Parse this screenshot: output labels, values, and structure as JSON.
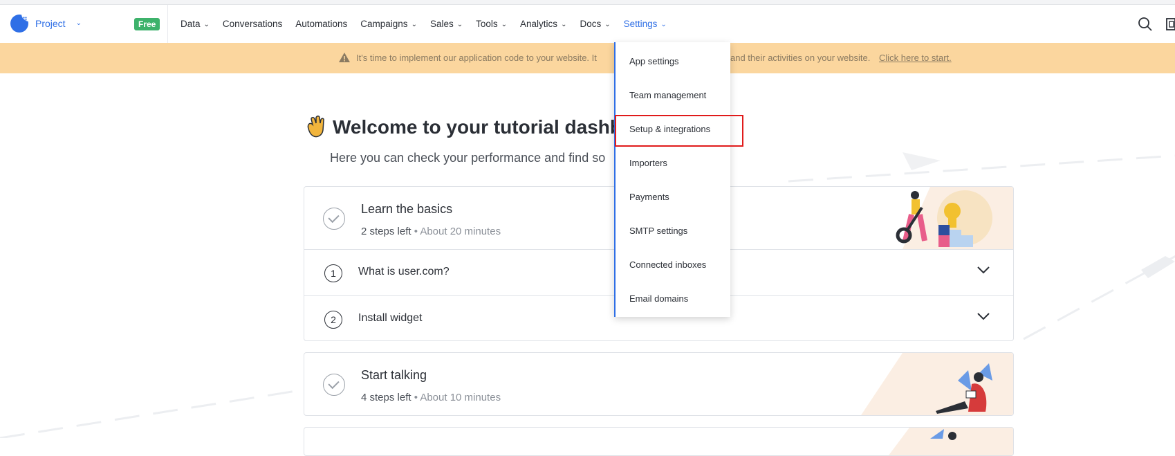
{
  "navbar": {
    "project_label": "Project",
    "free_badge": "Free",
    "menu": [
      {
        "label": "Data",
        "has_dropdown": true
      },
      {
        "label": "Conversations",
        "has_dropdown": false
      },
      {
        "label": "Automations",
        "has_dropdown": false
      },
      {
        "label": "Campaigns",
        "has_dropdown": true
      },
      {
        "label": "Sales",
        "has_dropdown": true
      },
      {
        "label": "Tools",
        "has_dropdown": true
      },
      {
        "label": "Analytics",
        "has_dropdown": true
      },
      {
        "label": "Docs",
        "has_dropdown": true
      },
      {
        "label": "Settings",
        "has_dropdown": true,
        "active": true
      }
    ],
    "icons": [
      "search-icon",
      "clipboard-icon"
    ],
    "accent_color": "#2f6fe6"
  },
  "banner": {
    "text": "It's time to implement our application code to your website. It",
    "text_tail": "and their activities on your website.",
    "link": "Click here to start.",
    "color": "#fbd69e"
  },
  "main": {
    "welcome_title": "Welcome to your tutorial dashbo",
    "subtitle": "Here you can check your performance and find so",
    "cards": [
      {
        "title": "Learn the basics",
        "steps_left": "2 steps left",
        "separator": "•",
        "duration": "About 20 minutes",
        "steps": [
          {
            "number": "1",
            "label": "What is user.com?"
          },
          {
            "number": "2",
            "label": "Install widget"
          }
        ]
      },
      {
        "title": "Start talking",
        "steps_left": "4 steps left",
        "separator": "•",
        "duration": "About 10 minutes",
        "steps": []
      }
    ]
  },
  "settings_dropdown": {
    "items": [
      "App settings",
      "Team management",
      "Setup & integrations",
      "Importers",
      "Payments",
      "SMTP settings",
      "Connected inboxes",
      "Email domains"
    ],
    "highlighted_item": "Setup & integrations",
    "highlight_color": "#e01b1b"
  }
}
